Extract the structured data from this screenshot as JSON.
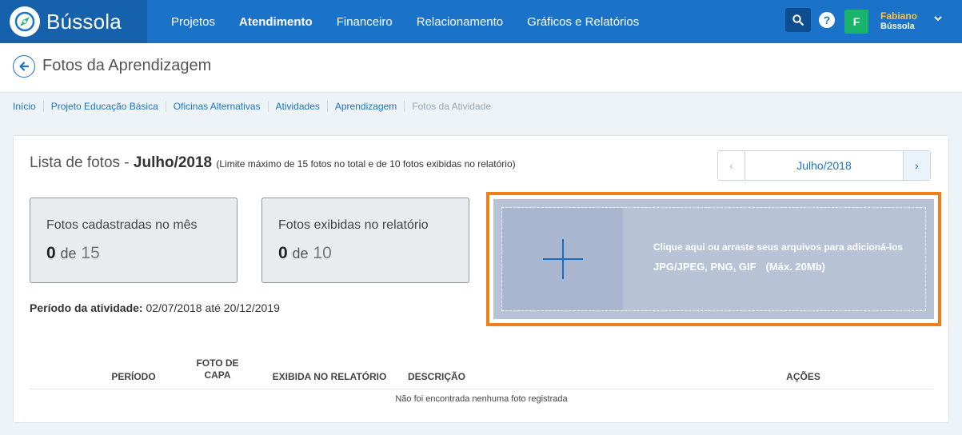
{
  "app": {
    "brand": "Bússola",
    "nav": [
      "Projetos",
      "Atendimento",
      "Financeiro",
      "Relacionamento",
      "Gráficos e Relatórios"
    ],
    "active_nav": "Atendimento",
    "help_label": "?",
    "user": {
      "initial": "F",
      "name": "Fabiano",
      "org": "Bússola"
    }
  },
  "page": {
    "title": "Fotos da Aprendizagem",
    "breadcrumb": [
      "Início",
      "Projeto Educação Básica",
      "Oficinas Alternativas",
      "Atividades",
      "Aprendizagem",
      "Fotos da Atividade"
    ]
  },
  "list": {
    "title_prefix": "Lista de fotos - ",
    "month": "Julho/2018",
    "note": "(Limite máximo de 15 fotos no total e de 10 fotos exibidas no relatório)",
    "month_nav_label": "Julho/2018",
    "prev_icon": "‹",
    "next_icon": "›",
    "stats": [
      {
        "label": "Fotos cadastradas no mês",
        "current": "0",
        "sep": "de",
        "total": "15"
      },
      {
        "label": "Fotos exibidas no relatório",
        "current": "0",
        "sep": "de",
        "total": "10"
      }
    ],
    "period_label": "Período da atividade:",
    "period_value": "02/07/2018 até 20/12/2019"
  },
  "upload": {
    "line1": "Clique aqui ou arraste seus arquivos para adicioná-los",
    "formats": "JPG/JPEG, PNG, GIF",
    "max": "(Máx. 20Mb)"
  },
  "table": {
    "headers": [
      "PERÍODO",
      "FOTO DE CAPA",
      "EXIBIDA NO RELATÓRIO",
      "DESCRIÇÃO",
      "AÇÕES"
    ],
    "empty_message": "Não foi encontrada nenhuma foto registrada"
  },
  "colors": {
    "primary": "#1a73c8",
    "accent": "#f07f1a",
    "avatar": "#19b36b",
    "user_name": "#f5c242"
  }
}
